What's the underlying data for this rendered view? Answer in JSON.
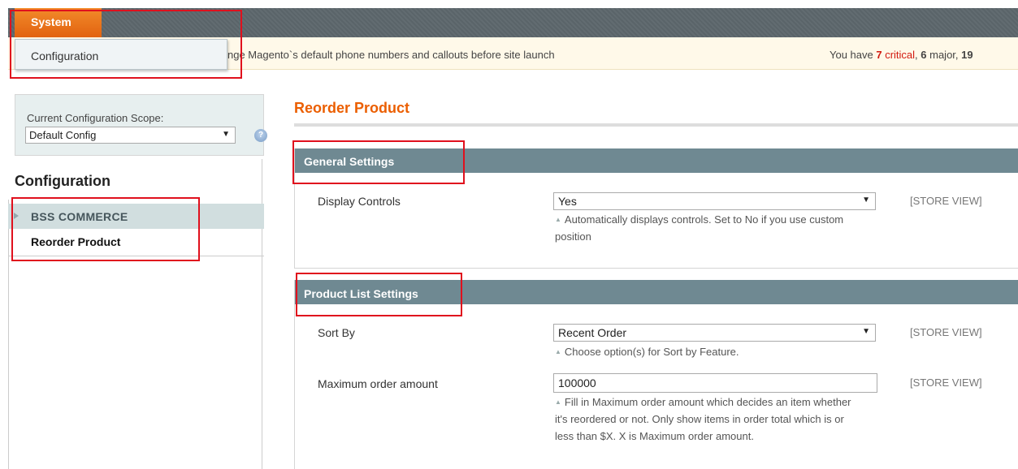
{
  "nav": {
    "system": "System"
  },
  "dropdown": {
    "configuration": "Configuration"
  },
  "notice": {
    "message": "nge Magento`s default phone numbers and callouts before site launch",
    "prefix": "You have ",
    "critical_count": "7",
    "critical_label": " critical",
    "sep1": ", ",
    "major_count": "6",
    "major_label": " major, ",
    "more_count": "19"
  },
  "sidebar": {
    "scope_label": "Current Configuration Scope:",
    "scope_value": "Default Config",
    "help_icon": "help-icon",
    "title": "Configuration",
    "group": "BSS COMMERCE",
    "item": "Reorder Product"
  },
  "main": {
    "title": "Reorder Product",
    "general": {
      "heading": "General Settings",
      "display_controls": {
        "label": "Display Controls",
        "value": "Yes",
        "note": "Automatically displays controls. Set to No if you use custom position",
        "scope": "[STORE VIEW]"
      }
    },
    "product_list": {
      "heading": "Product List Settings",
      "sort_by": {
        "label": "Sort By",
        "value": "Recent Order",
        "note": "Choose option(s) for Sort by Feature.",
        "scope": "[STORE VIEW]"
      },
      "max_amount": {
        "label": "Maximum order amount",
        "value": "100000",
        "note": "Fill in Maximum order amount which decides an item whether it's reordered or not. Only show items in order total which is or less than $X. X is Maximum order amount.",
        "scope": "[STORE VIEW]"
      }
    }
  },
  "colors": {
    "accent": "#eb5e00",
    "highlight": "#e0101d",
    "section_header": "#6f8992"
  }
}
